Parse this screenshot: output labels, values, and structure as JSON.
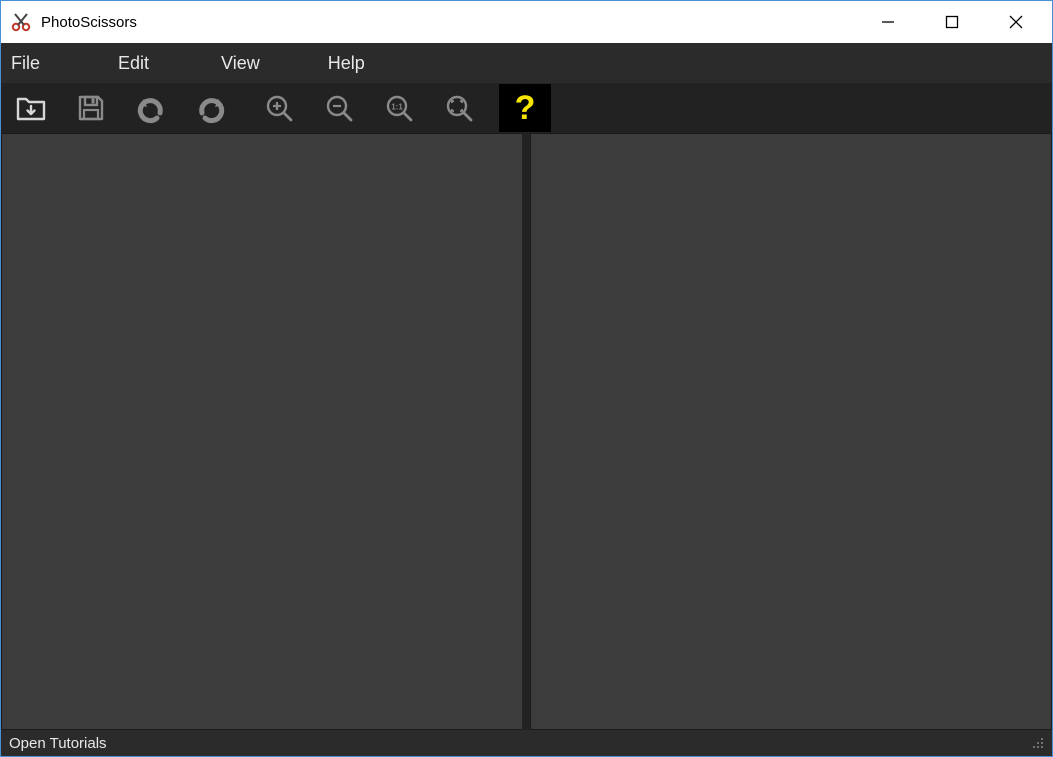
{
  "window": {
    "title": "PhotoScissors"
  },
  "menubar": {
    "file": "File",
    "edit": "Edit",
    "view": "View",
    "help": "Help"
  },
  "toolbar": {
    "help_glyph": "?"
  },
  "statusbar": {
    "text": "Open Tutorials"
  },
  "colors": {
    "accent": "#f7e500",
    "icon": "#8a8a8a",
    "bg_dark": "#222222",
    "bg_pane": "#3c3c3c"
  }
}
